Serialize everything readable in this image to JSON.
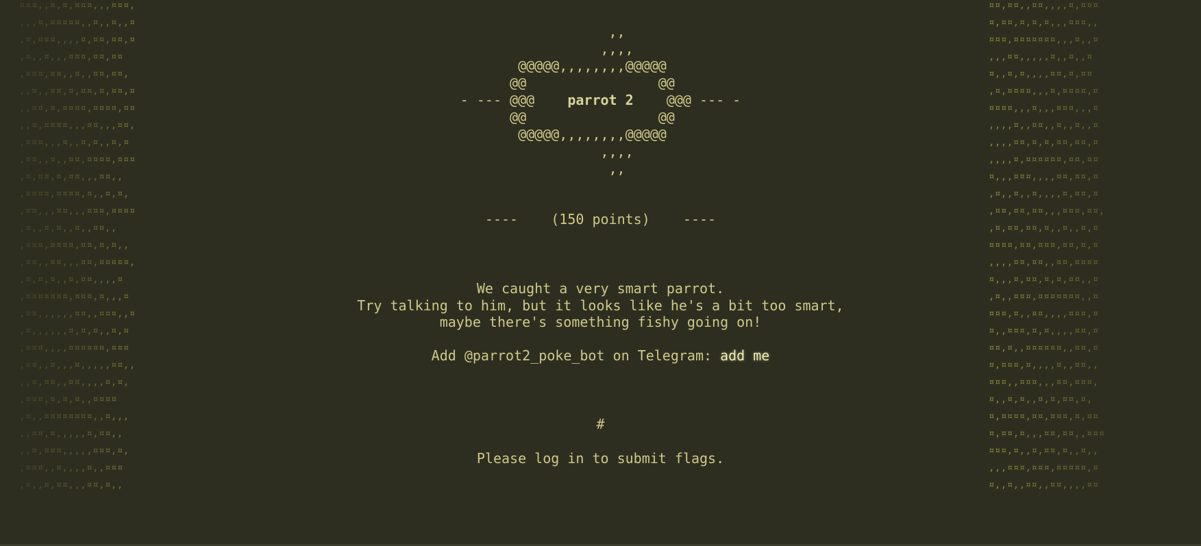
{
  "pattern": {
    "left": [
      "¤¤¤,,¤,¤,¤¤¤,,,¤¤¤,",
      ",,,¤,¤¤¤¤¤,,¤,,¤,,¤",
      ",¤,¤¤¤,,,,¤,¤¤,¤¤,¤",
      ",¤,,¤,,,¤¤¤,¤¤,¤¤",
      ",¤¤¤,¤¤,,¤,,¤¤,¤¤,",
      ",,¤,,¤¤,¤,¤¤,¤,¤¤,¤",
      ",,¤¤,¤,¤¤¤¤,¤¤¤¤,¤¤",
      ",,¤,¤¤¤¤,,,¤¤,,,¤¤,",
      ",¤¤¤,,,¤,,¤,¤,,¤,¤",
      ",¤¤,,¤,,¤¤,¤¤¤¤,¤¤¤",
      ",¤,¤¤,¤,¤¤,,,¤¤,,",
      ",¤¤¤¤,¤¤¤¤,¤,,¤,¤,",
      ",¤¤,,,¤¤,,,¤¤¤,¤¤¤¤",
      ",¤,,¤,¤,,¤,,¤¤,,",
      ",¤¤¤,¤¤¤¤,¤¤,¤,¤,,",
      ",¤¤,,¤¤,,,¤¤,¤¤¤¤¤,",
      ",¤,¤,¤,,¤,¤¤,,,,¤",
      ",¤¤¤¤¤¤¤,¤¤¤,¤,,,¤",
      ",¤¤,,,,,,¤¤,,¤¤¤,,¤",
      ",¤,,,,,,¤,¤,¤,,¤,¤",
      ",¤¤¤,,,,¤¤¤¤¤¤,¤¤¤",
      ",¤¤,,¤,,,¤,,,,,¤¤,,",
      ",,¤,¤¤,,¤¤,,,,¤,¤,",
      ",¤¤¤,¤,¤,¤,,¤¤¤¤",
      ",¤,,¤¤¤¤¤¤¤¤,,¤,,,",
      ",,¤¤,¤,,,,,¤,¤¤,,",
      ",,¤,¤¤¤,,,,,¤¤¤,¤,",
      ",¤¤¤,,¤,,,,¤,,¤¤¤",
      ",¤,,¤,¤¤,,,¤¤,¤,,"
    ],
    "right": [
      "¤¤,¤¤,,¤¤,,,,¤,¤¤¤",
      "¤,¤¤,¤,¤,¤,,,¤¤¤,,",
      "¤¤¤,¤¤¤¤¤¤¤,,,¤,,¤",
      ",,,¤¤,,,,,¤,,¤,,¤",
      "¤,,¤,¤,,,,¤¤,¤,¤¤",
      ",¤,¤¤¤¤,,,¤,¤¤¤¤,¤",
      "¤¤¤¤,,,¤,,,¤¤¤,,,¤",
      ",,,,¤,,¤¤,,¤,,¤,,¤",
      ",,,,¤¤,¤,¤,¤¤,¤¤,¤",
      ",,,,¤,¤¤¤¤¤¤,¤¤,¤¤",
      "¤,,,¤¤¤,,,,¤¤,¤¤,¤",
      ",¤,,¤,,¤,,,,¤,¤¤,¤",
      ",¤¤,¤¤,¤¤,,,¤¤¤,¤¤,",
      ",¤,¤¤,¤¤,¤,,¤,,¤,¤",
      "¤¤¤¤,¤¤,¤¤¤,¤¤,¤,¤",
      ",,,,¤¤,¤¤,,¤¤,¤¤¤¤",
      "¤,,,¤,¤¤,¤,¤,¤¤,,¤",
      ",¤,,¤¤¤,¤¤¤¤¤¤¤,,¤",
      "¤¤¤,¤,,¤¤,,,,¤¤¤,¤",
      "¤,,¤¤¤,¤,¤,,,,¤¤,¤",
      "¤¤,¤,,¤¤¤¤¤¤,,¤¤,¤",
      "¤,¤¤¤,¤,,,,¤,,¤¤,,",
      "¤¤¤,,¤¤¤,,,¤¤,¤¤¤,",
      "¤,,¤,¤,,¤,¤,¤¤,¤,",
      "¤,¤¤¤¤,¤¤,¤¤¤,¤,¤¤",
      "¤,¤¤,¤,,,¤¤,¤¤,,¤¤¤",
      "¤¤¤,¤,,¤,¤¤,¤,,¤,,",
      ",,,¤¤¤,¤¤¤,¤¤¤¤¤,¤",
      "¤,,¤,,¤¤,,¤¤,,,,¤¤"
    ]
  },
  "banner": {
    "ascii_art_top": "                  ,,\n                 ,,,,\n       @@@@@,,,,,,,,@@@@@\n      @@                @@\n- --- @@@",
    "challenge_name": "parrot 2",
    "ascii_art_bottom": "@@@ --- -\n      @@                @@\n       @@@@@,,,,,,,,@@@@@\n                 ,,,,\n                  ,,"
  },
  "challenge": {
    "points_line": "----    (150 points)    ----",
    "description": "We caught a very smart parrot.\nTry talking to him, but it looks like he's a bit too smart,\nmaybe there's something fishy going on!",
    "telegram_prefix": "Add @parrot2_poke_bot on Telegram: ",
    "add_me_label": "add me",
    "hash": "#",
    "login_message": "Please log in to submit flags."
  }
}
